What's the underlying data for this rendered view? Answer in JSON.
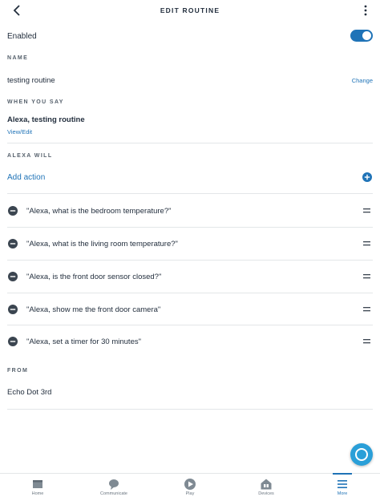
{
  "header": {
    "title": "EDIT ROUTINE"
  },
  "enabled": {
    "label": "Enabled",
    "on": true
  },
  "name": {
    "section_label": "NAME",
    "value": "testing routine",
    "change_label": "Change"
  },
  "when_you_say": {
    "section_label": "WHEN YOU SAY",
    "phrase": "Alexa, testing routine",
    "view_edit_label": "View/Edit"
  },
  "alexa_will": {
    "section_label": "ALEXA WILL",
    "add_action_label": "Add action",
    "actions": [
      "\"Alexa, what is the bedroom temperature?\"",
      "\"Alexa, what is the living room temperature?\"",
      "\"Alexa, is the front door sensor closed?\"",
      "\"Alexa, show me the front door camera\"",
      "\"Alexa, set a timer for 30 minutes\""
    ]
  },
  "from": {
    "section_label": "FROM",
    "device": "Echo Dot 3rd"
  },
  "bottom_nav": {
    "items": [
      {
        "label": "Home",
        "icon": "home-icon"
      },
      {
        "label": "Communicate",
        "icon": "chat-bubble-icon"
      },
      {
        "label": "Play",
        "icon": "play-icon"
      },
      {
        "label": "Devices",
        "icon": "devices-icon"
      },
      {
        "label": "More",
        "icon": "menu-icon"
      }
    ],
    "active": "More"
  },
  "colors": {
    "accent": "#1f73b7",
    "text": "#232f3e",
    "muted": "#56616c",
    "divider": "#e3e6e8",
    "fab": "#2a9fd8",
    "nav_icon": "#7f8a93"
  }
}
